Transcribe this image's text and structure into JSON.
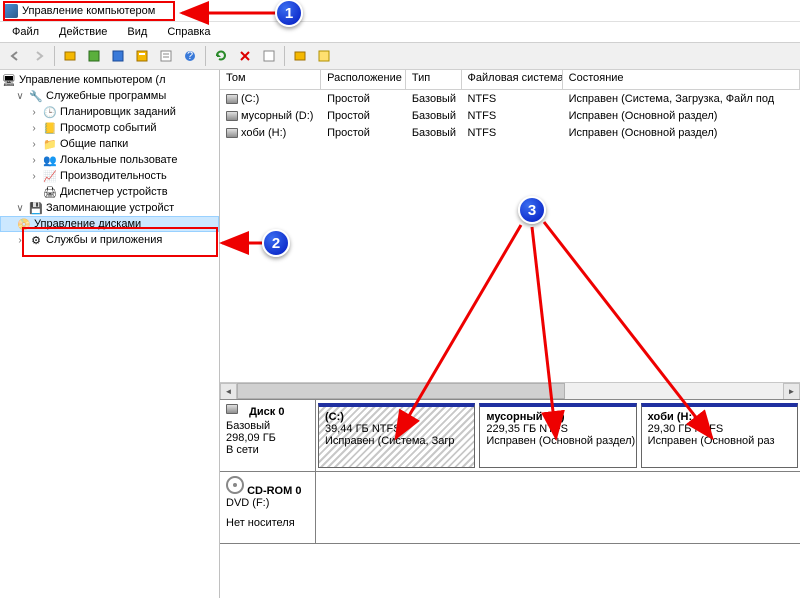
{
  "window": {
    "title": "Управление компьютером"
  },
  "menu": {
    "file": "Файл",
    "action": "Действие",
    "view": "Вид",
    "help": "Справка"
  },
  "tree": {
    "root": "Управление компьютером (л",
    "sys_tools": "Служебные программы",
    "scheduler": "Планировщик заданий",
    "events": "Просмотр событий",
    "shared": "Общие папки",
    "users": "Локальные пользовате",
    "perf": "Производительность",
    "devmgr": "Диспетчер устройств",
    "storage": "Запоминающие устройст",
    "diskmgmt": "Управление дисками",
    "services": "Службы и приложения"
  },
  "cols": {
    "vol": "Том",
    "layout": "Расположение",
    "type": "Тип",
    "fs": "Файловая система",
    "status": "Состояние"
  },
  "col_w": {
    "vol": 110,
    "layout": 92,
    "type": 60,
    "fs": 110,
    "status": 260
  },
  "volumes": [
    {
      "name": "(C:)",
      "layout": "Простой",
      "type": "Базовый",
      "fs": "NTFS",
      "status": "Исправен (Система, Загрузка, Файл под"
    },
    {
      "name": "мусорный (D:)",
      "layout": "Простой",
      "type": "Базовый",
      "fs": "NTFS",
      "status": "Исправен (Основной раздел)"
    },
    {
      "name": "хоби (H:)",
      "layout": "Простой",
      "type": "Базовый",
      "fs": "NTFS",
      "status": "Исправен (Основной раздел)"
    }
  ],
  "disk0": {
    "name": "Диск 0",
    "type": "Базовый",
    "size": "298,09 ГБ",
    "state": "В сети",
    "parts": [
      {
        "name": "(C:)",
        "size": "39,44 ГБ NTFS",
        "status": "Исправен (Система, Загр"
      },
      {
        "name": "мусорный (D:)",
        "size": "229,35 ГБ NTFS",
        "status": "Исправен (Основной раздел)"
      },
      {
        "name": "хоби (H:)",
        "size": "29,30 ГБ NTFS",
        "status": "Исправен (Основной раз"
      }
    ]
  },
  "cdrom": {
    "name": "CD-ROM 0",
    "type": "DVD (F:)",
    "state": "Нет носителя"
  },
  "badges": {
    "b1": "1",
    "b2": "2",
    "b3": "3"
  }
}
